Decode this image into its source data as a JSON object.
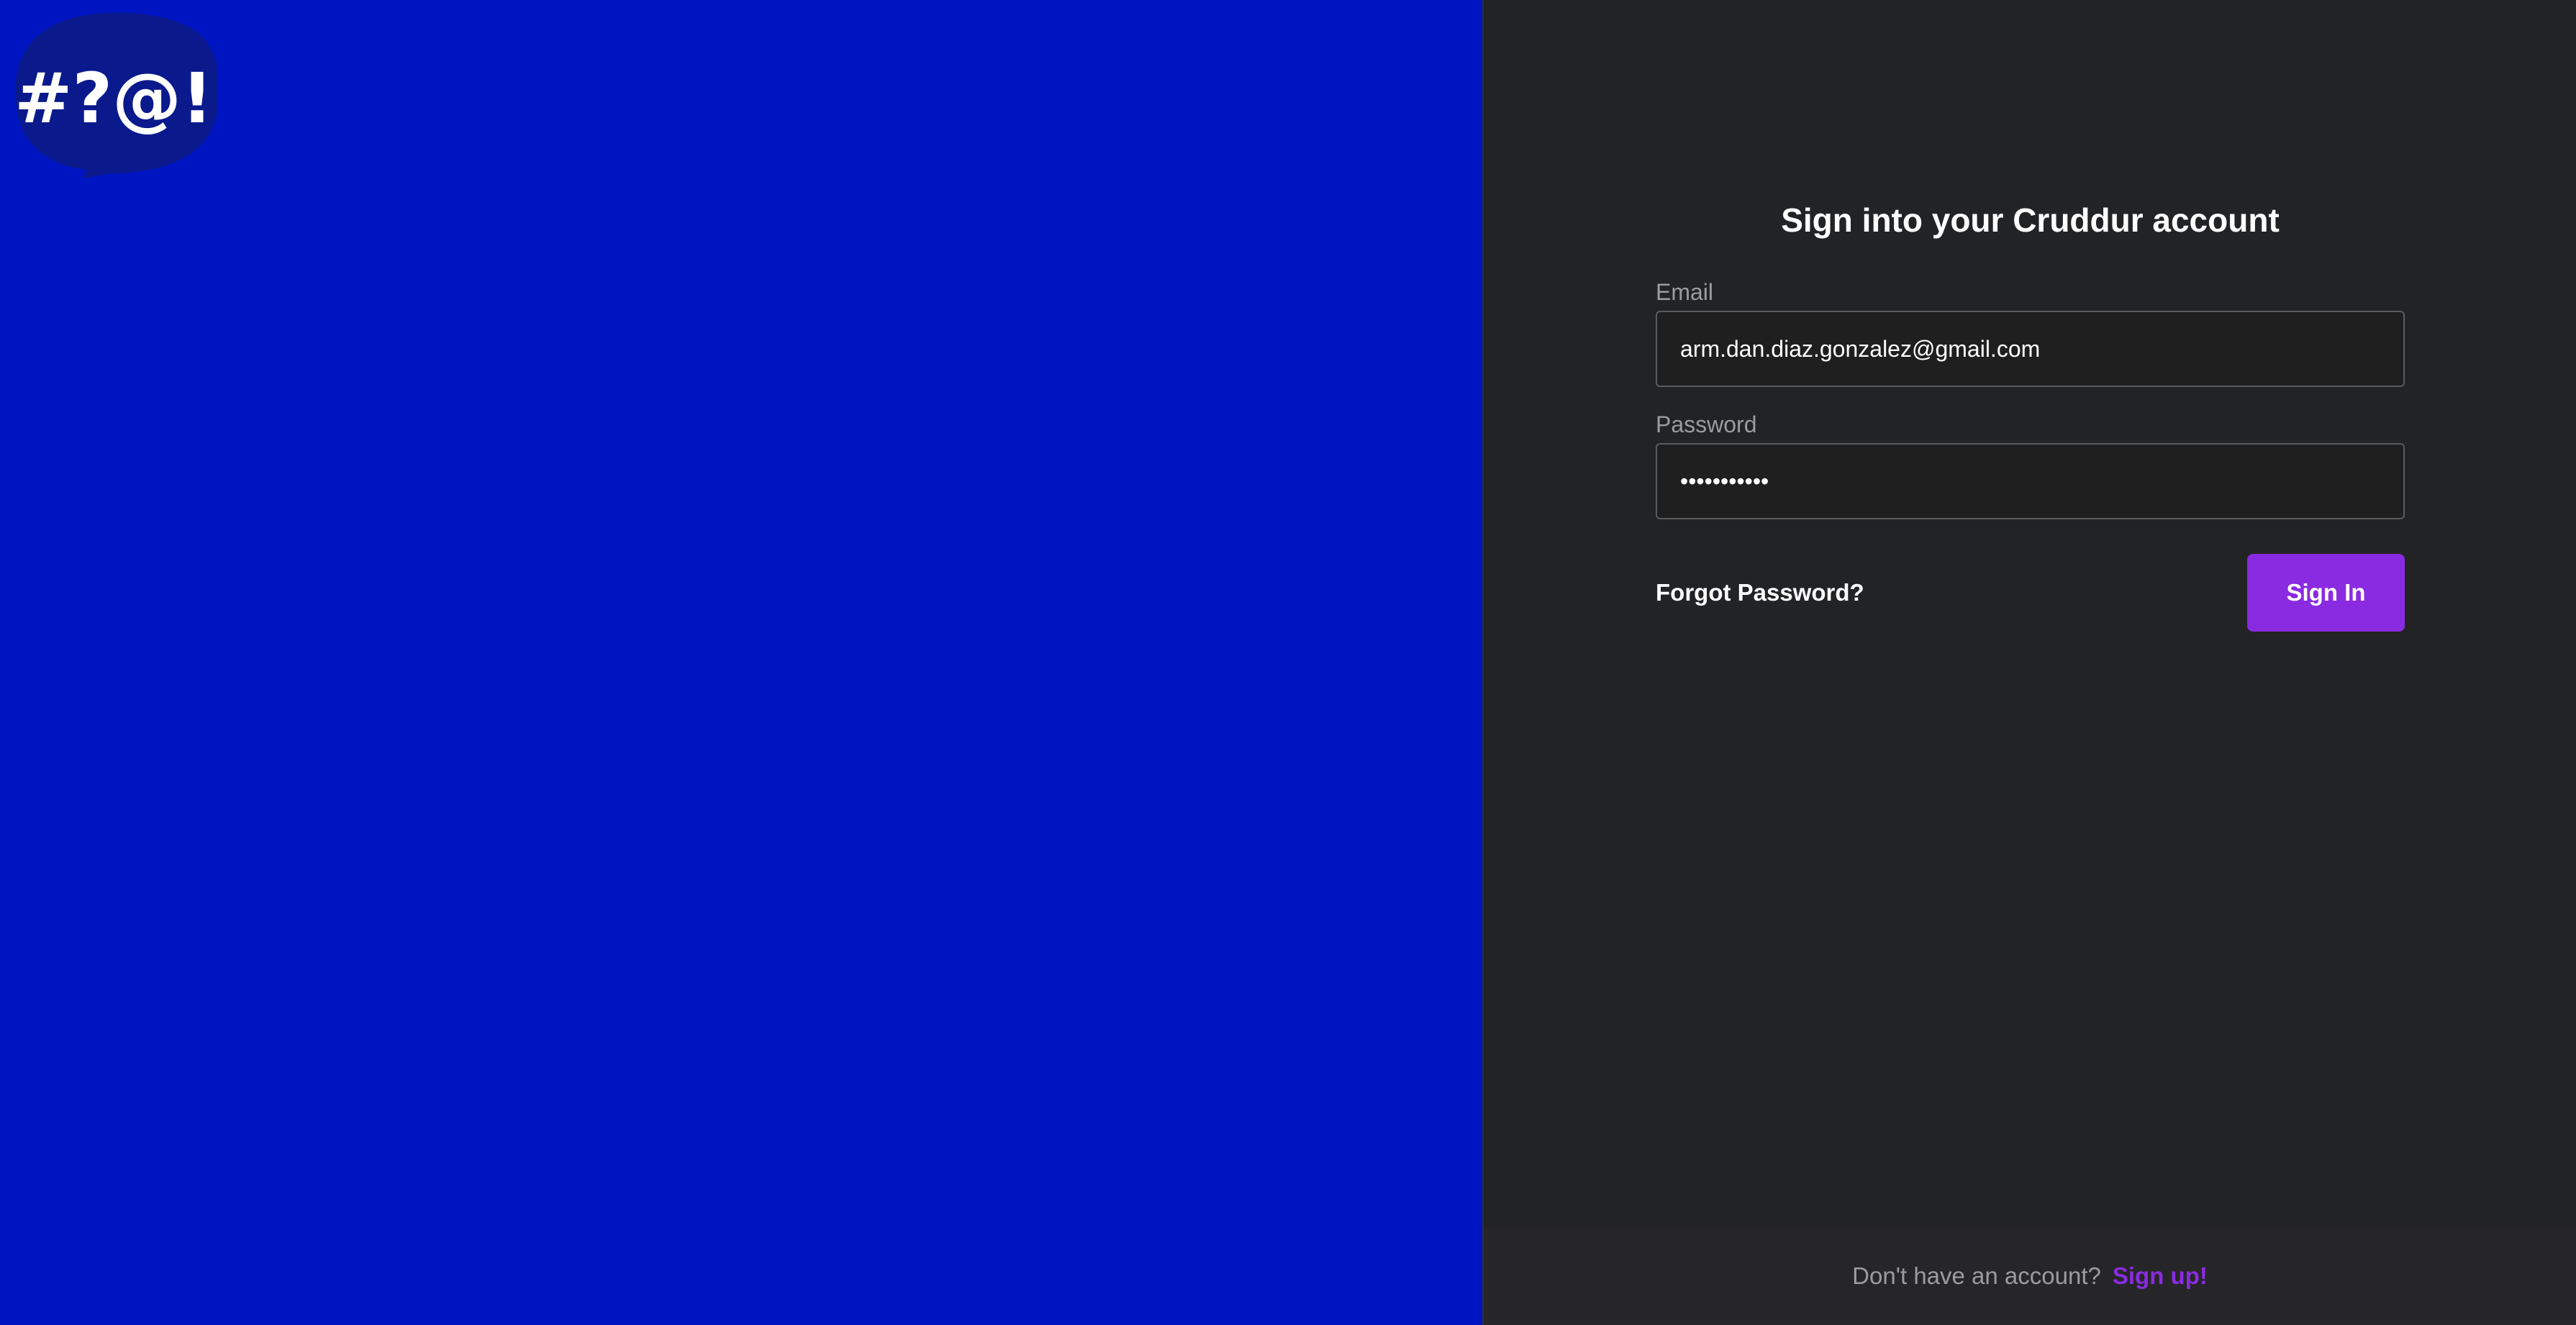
{
  "logo": {
    "text": "#?@!",
    "bubble_color": "#0a1a8c",
    "text_color": "#ffffff"
  },
  "colors": {
    "left_panel_bg": "#0015c2",
    "right_panel_bg": "#222325",
    "accent": "#8a2be2",
    "footer_bg": "#262628"
  },
  "signin": {
    "title": "Sign into your Cruddur account",
    "email_label": "Email",
    "email_value": "arm.dan.diaz.gonzalez@gmail.com",
    "password_label": "Password",
    "password_value": "•••••••••••",
    "forgot_label": "Forgot Password?",
    "submit_label": "Sign In"
  },
  "footer": {
    "prompt": "Don't have an account?",
    "signup_label": "Sign up!"
  }
}
